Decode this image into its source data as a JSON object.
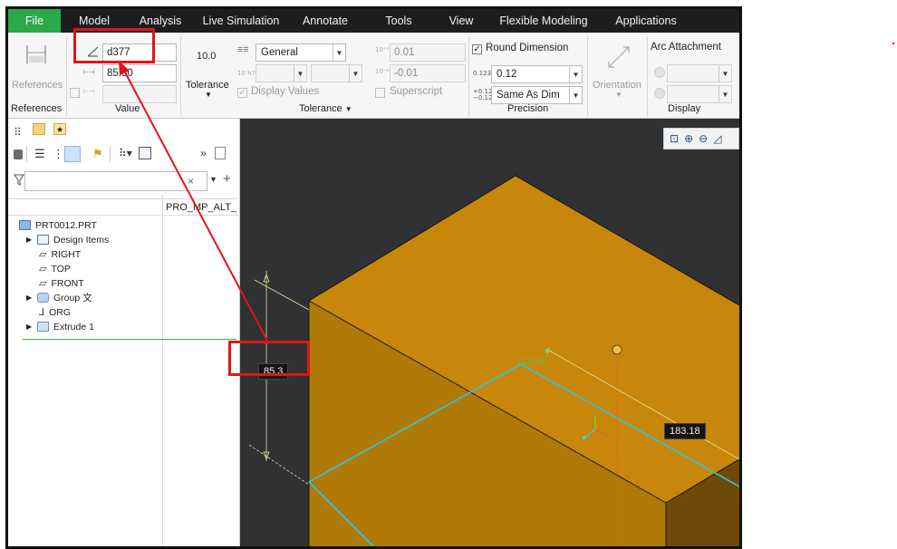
{
  "menubar": {
    "items": [
      "File",
      "Model",
      "Analysis",
      "Live Simulation",
      "Annotate",
      "Tools",
      "View",
      "Flexible Modeling",
      "Applications"
    ],
    "file_color": "#2aa84a"
  },
  "ribbon": {
    "references": {
      "button_label": "References",
      "group_label": "References"
    },
    "value": {
      "name_value": "d377",
      "dim_value": "85.30",
      "group_label": "Value"
    },
    "tolerance": {
      "nominal_value": "10.0",
      "tolerance_button_label": "Tolerance",
      "type_select": "General",
      "upper_value": "0.01",
      "lower_value": "-0.01",
      "display_values_label": "Display Values",
      "superscript_label": "Superscript",
      "group_label": "Tolerance"
    },
    "precision": {
      "round_dimension_label": "Round Dimension",
      "precision_select": "0.12",
      "tolerance_precision_select": "Same As Dim",
      "group_label": "Precision"
    },
    "orientation": {
      "label": "Orientation"
    },
    "display": {
      "arc_attachment_label": "Arc Attachment",
      "group_label": "Display"
    }
  },
  "tree": {
    "column_header": "PRO_MP_ALT_",
    "items": [
      "PRT0012.PRT",
      "Design Items",
      "RIGHT",
      "TOP",
      "FRONT",
      "Group",
      "ORG",
      "Extrude 1"
    ],
    "group_marker": "文"
  },
  "viewport": {
    "height_dimension": "85.3",
    "length_dimension": "183.18",
    "active_dim_label": "127.00"
  },
  "colors": {
    "solid_top": "#c8870a",
    "solid_front": "#b0780a",
    "edge_highlight": "#2cc3e8",
    "annotation_red": "#e0141b"
  }
}
